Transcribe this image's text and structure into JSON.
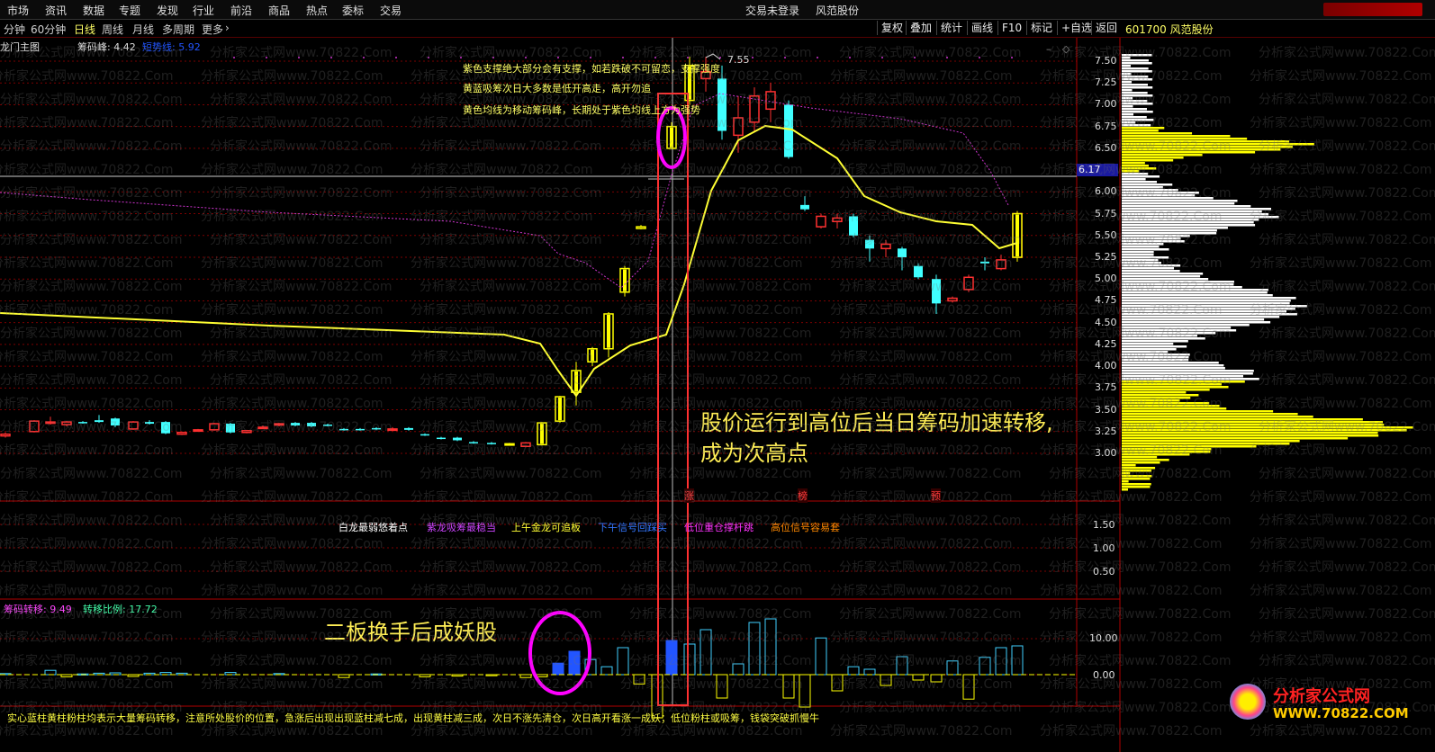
{
  "menubar": {
    "items": [
      "市场",
      "资讯",
      "数据",
      "专题",
      "发现",
      "行业",
      "前沿",
      "商品",
      "热点",
      "委标",
      "交易"
    ],
    "trade_status": "交易未登录",
    "broker": "风范股份"
  },
  "toolbar": {
    "periods": [
      "分钟",
      "60分钟",
      "日线",
      "周线",
      "月线",
      "多周期",
      "更多"
    ],
    "active_period": "日线",
    "buttons": [
      "复权",
      "叠加",
      "统计",
      "画线",
      "F10",
      "标记",
      "+自选",
      "返回"
    ],
    "stock": "601700 风范股份"
  },
  "main_chart": {
    "title": "龙门主图",
    "indicator_label": "筹码峰: 4.42",
    "indicator2_label": "短势线: 5.92",
    "peak_label": "7.55",
    "current_price": "6.17",
    "price_ticks": [
      "7.50",
      "7.25",
      "7.00",
      "6.75",
      "6.50",
      "6.00",
      "5.75",
      "5.50",
      "5.25",
      "5.00",
      "4.75",
      "4.50",
      "4.25",
      "4.00",
      "3.75",
      "3.50",
      "3.25",
      "3.00"
    ],
    "notes": [
      "紫色支撑绝大部分会有支撑，如若跌破不可留恋，支撑强度",
      "黄蓝吸筹次日大多数是低开高走，高开勿追",
      "黄色均线为移动筹码峰，长期处于紫色均线上方为强势"
    ],
    "big_annotation_line1": "股价运行到高位后当日筹码加速转移,",
    "big_annotation_line2": "成为次高点",
    "signal_marks": [
      "涨",
      "榜",
      "预"
    ]
  },
  "signal_panel": {
    "labels": [
      "白龙最弱悠着点",
      "紫龙吸筹最稳当",
      "上午金龙可追板",
      "下午信号回踩买",
      "低位重仓撑杆跳",
      "高位信号容易套"
    ],
    "ticks": [
      "1.50",
      "1.00",
      "0.50"
    ]
  },
  "bottom_panel": {
    "label1": "筹码转移: 9.49",
    "label2": "转移比例: 17.72",
    "ticks": [
      "10.00",
      "0.00"
    ],
    "annotation": "二板换手后成妖股",
    "footer": "实心蓝柱黄柱粉柱均表示大量筹码转移，注意所处股价的位置，急涨后出现出现蓝柱减七成，出现黄柱减三成，次日不涨先清仓，次日高开看涨一成妖；低位粉柱或吸筹，钱袋突破抓慢牛"
  },
  "watermark": "分析家公式网www.70822.Com",
  "logo": {
    "line1": "分析家公式网",
    "line2": "WWW.70822.COM"
  },
  "colors": {
    "up": "#ff3030",
    "down": "#40ffff",
    "yellow": "#ffff00",
    "purple": "#cc33cc",
    "magenta": "#ff00ff",
    "bg": "#000000"
  }
}
